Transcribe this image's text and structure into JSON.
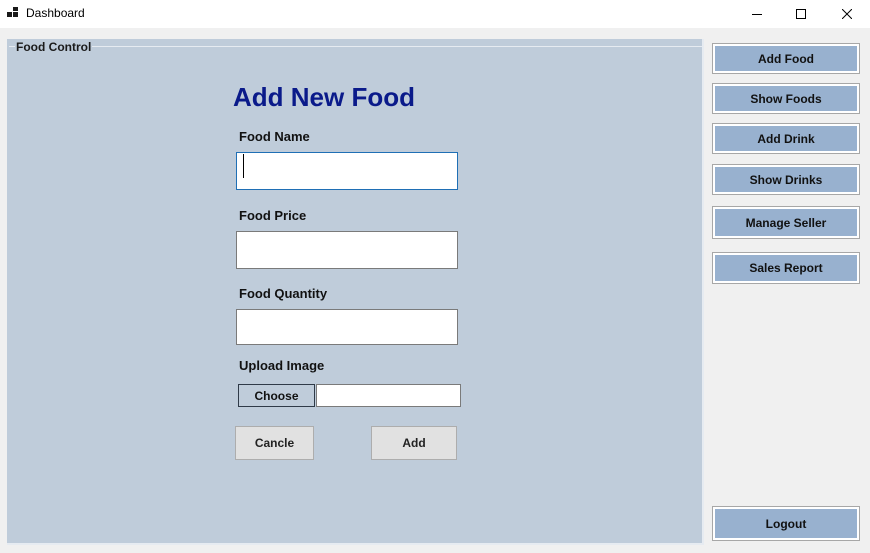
{
  "window": {
    "title": "Dashboard",
    "icon": "dashboard-app-icon",
    "controls": [
      "minimize",
      "maximize",
      "close"
    ]
  },
  "group": {
    "caption": "Food Control"
  },
  "form": {
    "heading": "Add New Food",
    "food_name_label": "Food Name",
    "food_name_value": "",
    "food_price_label": "Food Price",
    "food_price_value": "",
    "food_quantity_label": "Food Quantity",
    "food_quantity_value": "",
    "upload_image_label": "Upload Image",
    "choose_label": "Choose",
    "file_path_value": "",
    "cancel_label": "Cancle",
    "add_label": "Add"
  },
  "nav": {
    "add_food": "Add Food",
    "show_foods": "Show Foods",
    "add_drink": "Add Drink",
    "show_drinks": "Show Drinks",
    "manage_seller": "Manage Seller",
    "sales_report": "Sales Report",
    "logout": "Logout"
  },
  "colors": {
    "panel_background": "#bfccda",
    "heading": "#0a1a8a",
    "nav_button": "#98b1cf",
    "window_background": "#f0f0f0"
  }
}
